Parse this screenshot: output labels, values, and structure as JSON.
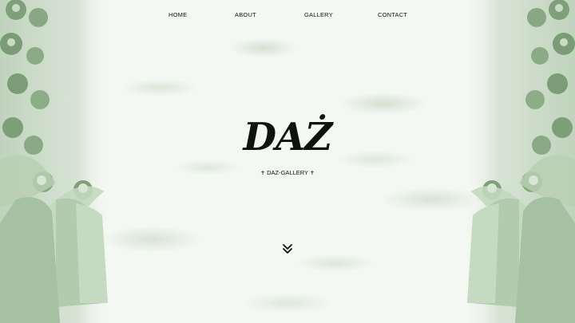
{
  "nav": {
    "home": "HOME",
    "about": "ABOUT",
    "gallery": "GALLERY",
    "contact": "CONTACT"
  },
  "hero": {
    "logo_text": "DAŻ",
    "subtitle": "DAZ-GALLERY",
    "subtitle_ornament": "✝"
  },
  "icons": {
    "scroll_down": "double-chevron-down-icon"
  },
  "colors": {
    "background": "#f4f8f3",
    "accent_green": "#7fa47a",
    "text": "#111111"
  }
}
